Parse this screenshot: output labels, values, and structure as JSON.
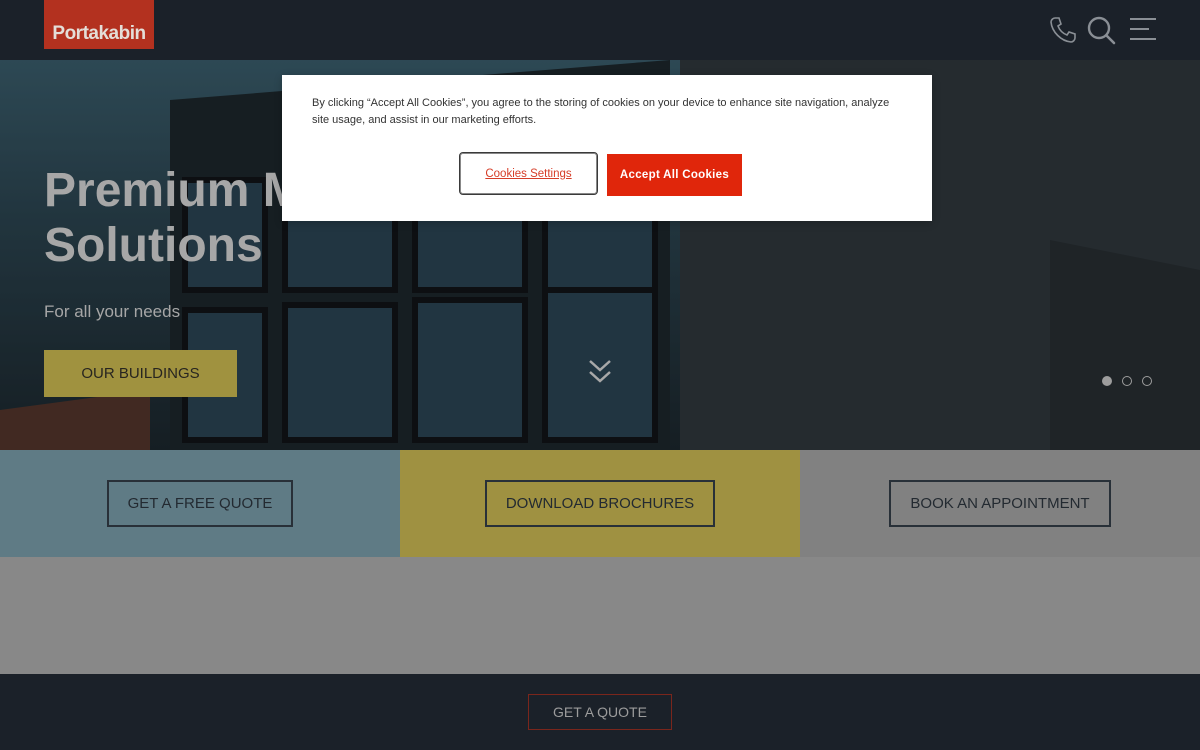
{
  "header": {
    "logo_text": "Portakabin",
    "icons": [
      "phone-icon",
      "search-icon",
      "menu-icon"
    ]
  },
  "hero": {
    "title": "Premium Modular Building Solutions",
    "subtitle": "For all your needs",
    "button_label": "OUR BUILDINGS",
    "slides": 3,
    "active_slide": 1
  },
  "actions": {
    "quote_label": "GET A FREE QUOTE",
    "brochures_label": "DOWNLOAD BROCHURES",
    "appointment_label": "BOOK AN APPOINTMENT"
  },
  "footer": {
    "quote_label": "GET A QUOTE"
  },
  "cookie_banner": {
    "text": "By clicking “Accept All Cookies”, you agree to the storing of cookies on your device to enhance site navigation, analyze site usage, and assist in our marketing efforts.",
    "settings_label": "Cookies Settings",
    "accept_label": "Accept All Cookies"
  },
  "colors": {
    "header_bg": "#1b2129",
    "logo_red": "#b3311f",
    "accent_gold": "#a0923f",
    "accept_red": "#e0260b"
  }
}
